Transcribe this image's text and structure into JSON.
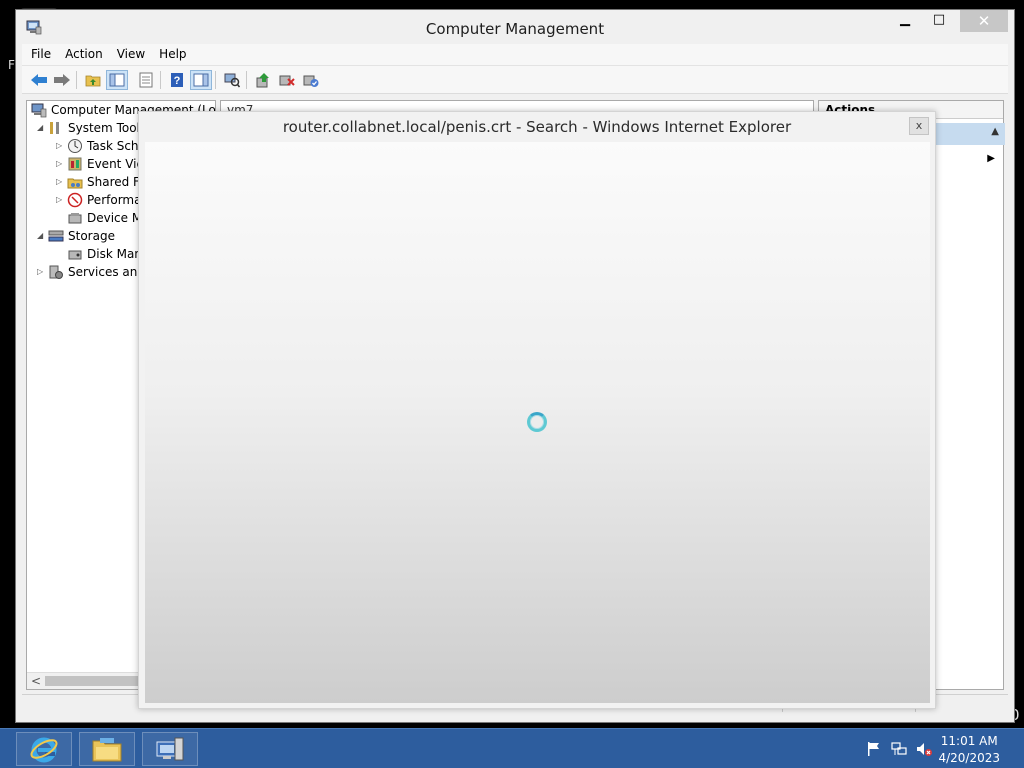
{
  "desktop": {
    "left_fragment": "F",
    "right_fragment": "0"
  },
  "window": {
    "title": "Computer Management",
    "minimize_glyph": "▁",
    "maximize_glyph": "□",
    "close_glyph": "✕"
  },
  "menu": {
    "items": [
      "File",
      "Action",
      "View",
      "Help"
    ]
  },
  "toolbar": {
    "buttons": [
      "back-icon",
      "forward-icon",
      "up-folder-icon",
      "show-hide-tree-icon",
      "properties-icon",
      "help-icon",
      "show-hide-action-pane-icon",
      "scan-hardware-icon",
      "update-driver-icon",
      "uninstall-device-icon",
      "enable-device-icon"
    ]
  },
  "tree": {
    "root": "Computer Management (Local",
    "items": [
      {
        "label": "System Tools",
        "level": 1,
        "expander": "◢"
      },
      {
        "label": "Task Sche",
        "level": 2,
        "expander": "▷"
      },
      {
        "label": "Event Vie",
        "level": 2,
        "expander": "▷"
      },
      {
        "label": "Shared Fo",
        "level": 2,
        "expander": "▷"
      },
      {
        "label": "Performa",
        "level": 2,
        "expander": "▷"
      },
      {
        "label": "Device M",
        "level": 2,
        "expander": ""
      },
      {
        "label": "Storage",
        "level": 1,
        "expander": "◢"
      },
      {
        "label": "Disk Man",
        "level": 2,
        "expander": ""
      },
      {
        "label": "Services and",
        "level": 1,
        "expander": "▷"
      }
    ],
    "scroll_left_glyph": "<"
  },
  "middle": {
    "header": "vm7"
  },
  "actions": {
    "header": "Actions",
    "up_glyph": "▲",
    "more_glyph": "▶"
  },
  "ie_dialog": {
    "title": "router.collabnet.local/penis.crt - Search - Windows Internet Explorer",
    "close_glyph": "x"
  },
  "taskbar": {
    "apps": [
      "internet-explorer-icon",
      "file-explorer-icon",
      "server-manager-icon"
    ],
    "clock_time": "11:01 AM",
    "clock_date": "4/20/2023"
  },
  "colors": {
    "taskbar": "#2d5d9e",
    "selection": "#c6dbef",
    "spinner": "#5ec9d3"
  }
}
